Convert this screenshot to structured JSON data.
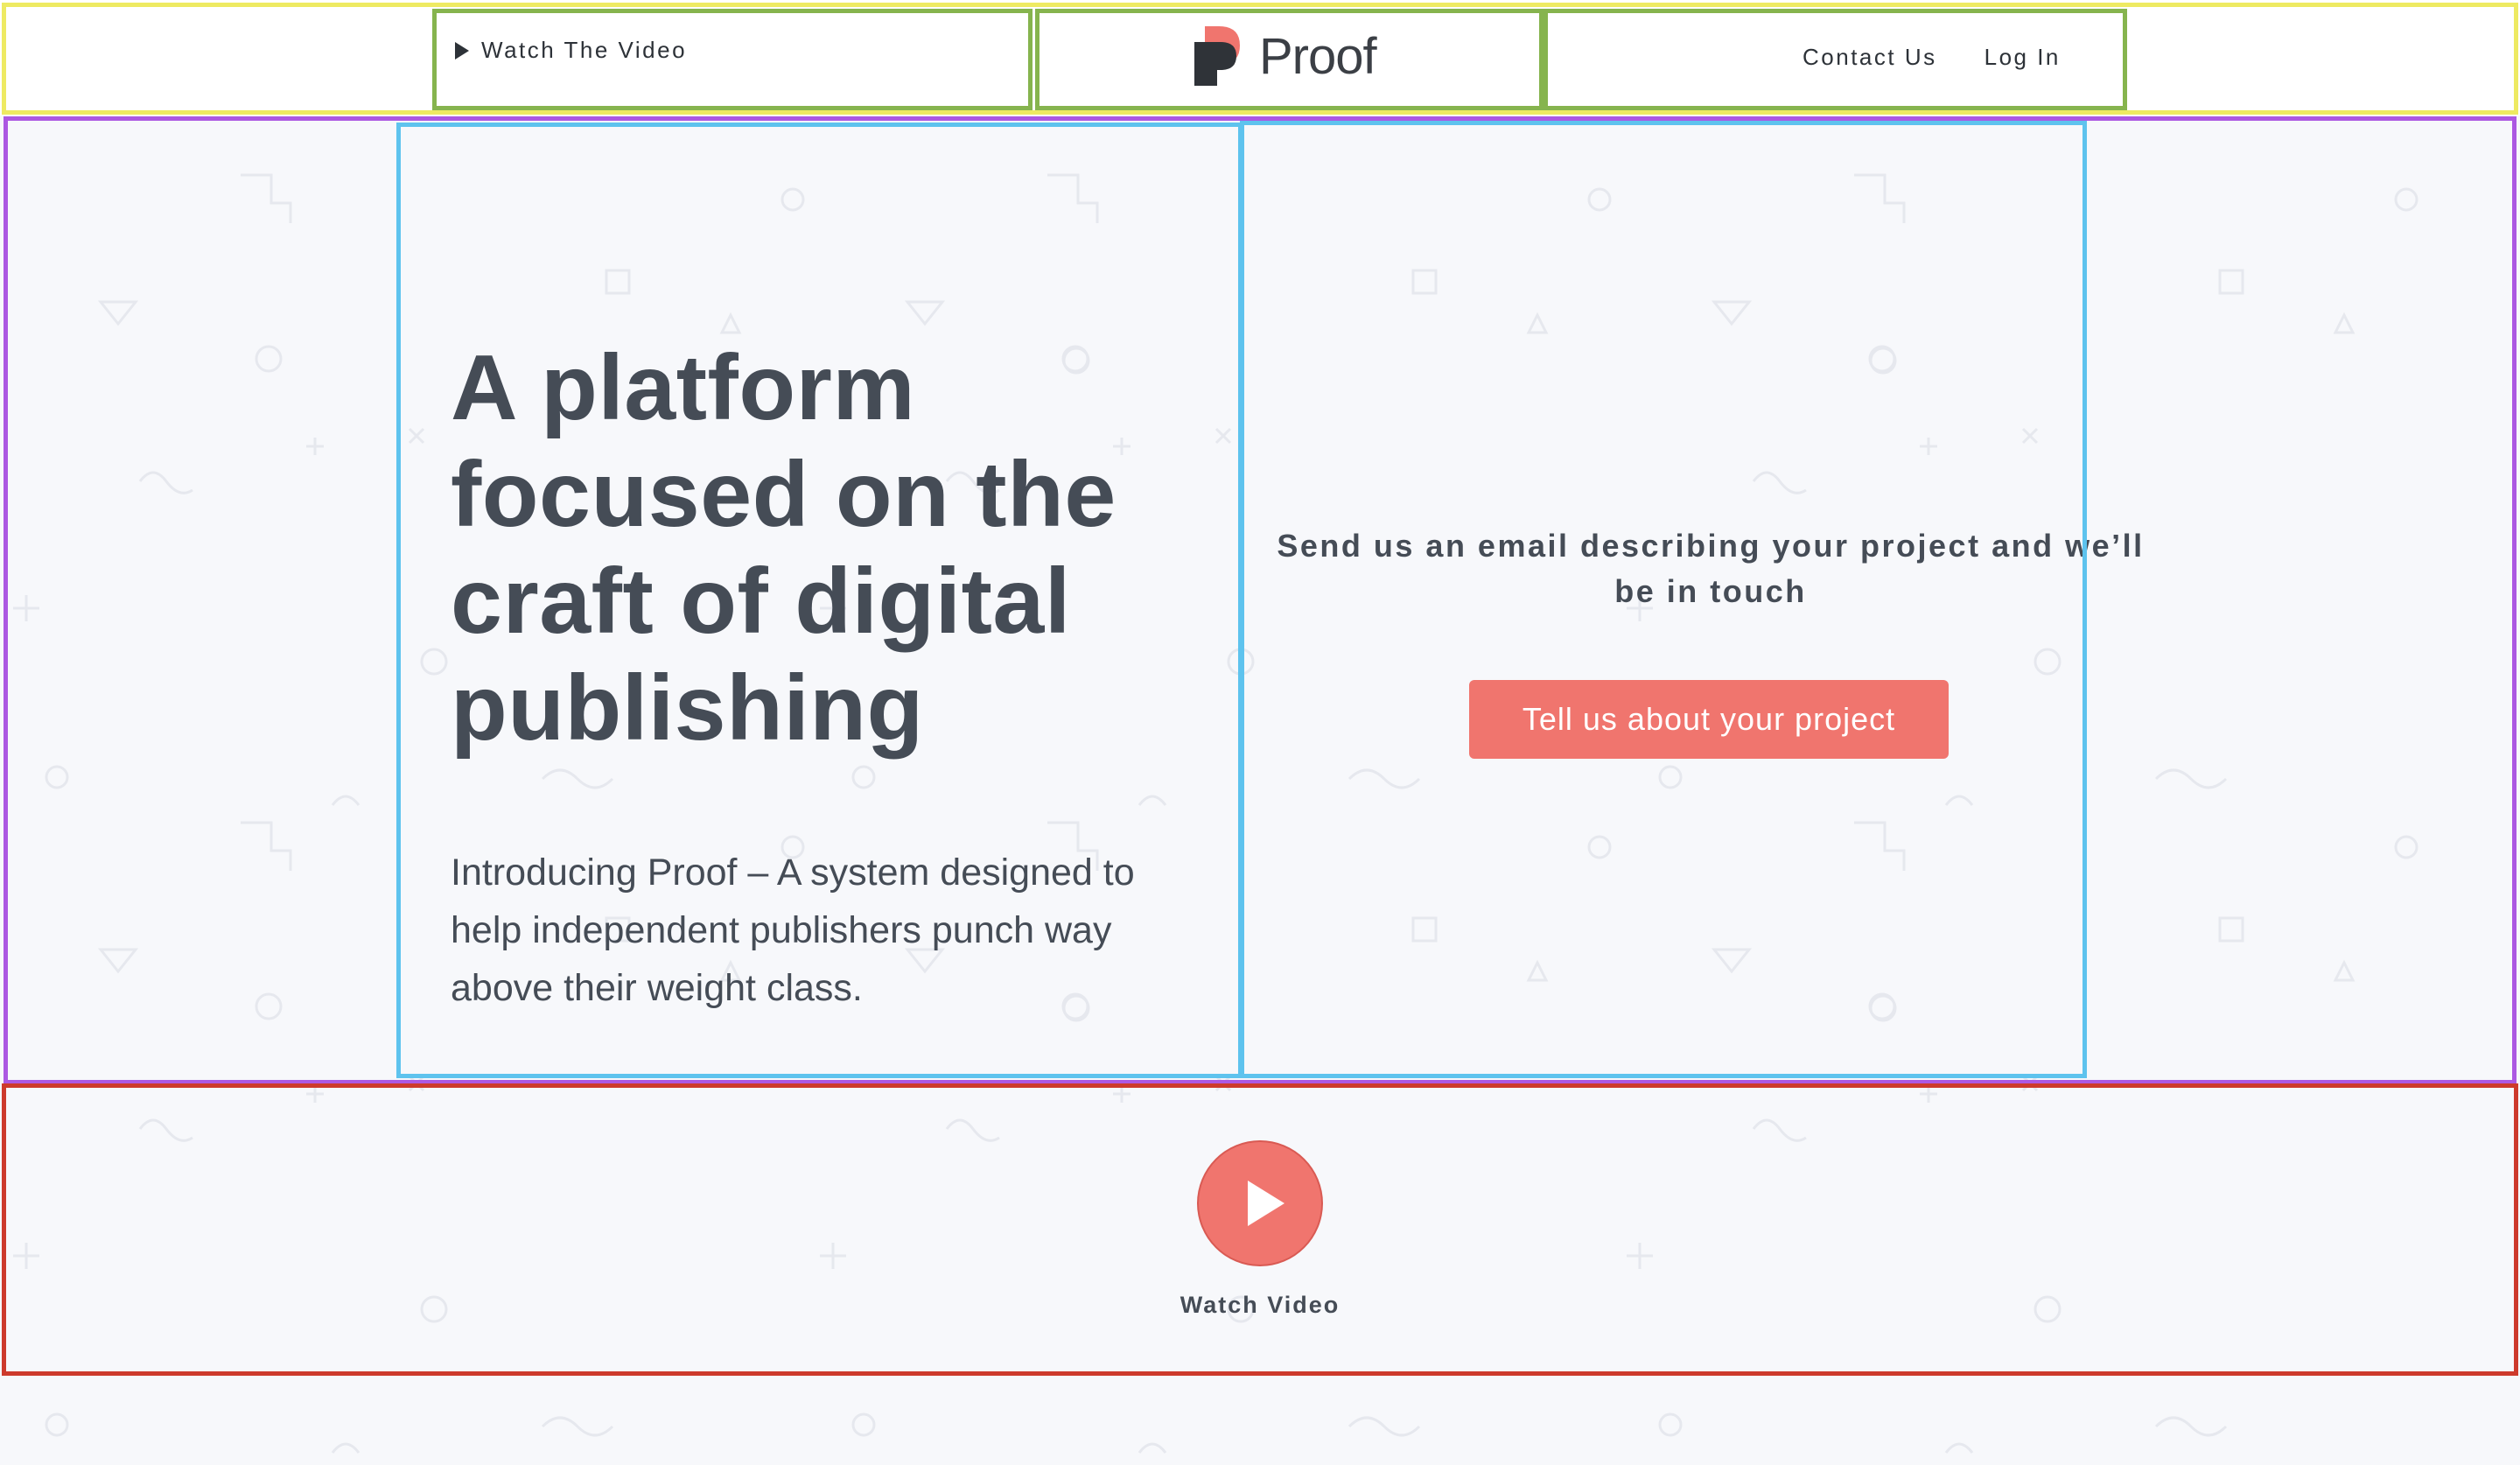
{
  "header": {
    "watch_label": "Watch The Video",
    "logo_text": "Proof",
    "nav": {
      "contact": "Contact Us",
      "login": "Log In"
    }
  },
  "hero": {
    "title": "A platform focused on the craft of digital publishing",
    "subtitle": "Introducing Proof – A system designed to help independent publishers punch way above their weight class."
  },
  "contact": {
    "text": "Send us an email describing your project and we’ll be in touch",
    "button": "Tell us about your project"
  },
  "video": {
    "label": "Watch Video"
  },
  "colors": {
    "accent": "#f0756e",
    "text": "#454c56",
    "background": "#f7f8fb"
  }
}
